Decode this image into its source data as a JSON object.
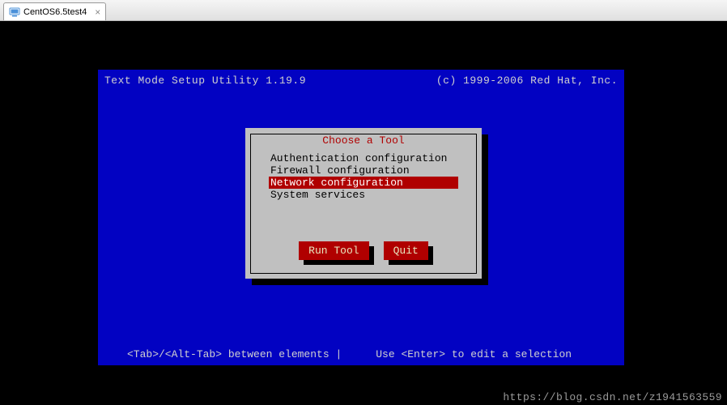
{
  "tab": {
    "label": "CentOS6.5test4"
  },
  "header": {
    "title": "Text Mode Setup Utility 1.19.9",
    "copyright": "(c) 1999-2006 Red Hat, Inc."
  },
  "dialog": {
    "title": "Choose a Tool",
    "items": [
      {
        "label": "Authentication configuration",
        "selected": false
      },
      {
        "label": "Firewall configuration",
        "selected": false
      },
      {
        "label": "Network configuration",
        "selected": true
      },
      {
        "label": "System services",
        "selected": false
      }
    ],
    "buttons": {
      "run": "Run Tool",
      "quit": "Quit"
    }
  },
  "footer": {
    "left": "<Tab>/<Alt-Tab> between elements   |",
    "right": "Use <Enter> to edit a selection"
  },
  "watermark": "https://blog.csdn.net/z1941563559"
}
